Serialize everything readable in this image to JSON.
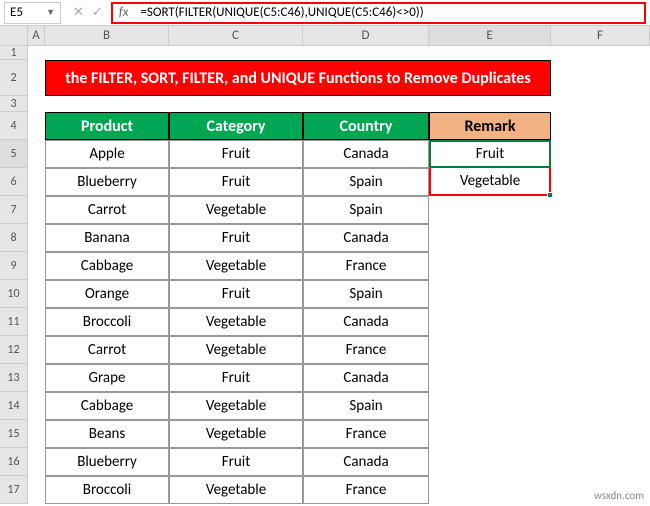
{
  "nameBox": "E5",
  "formula": "=SORT(FILTER(UNIQUE(C5:C46),UNIQUE(C5:C46)<>0))",
  "fxLabel": "fx",
  "banner": "the FILTER, SORT, FILTER, and UNIQUE Functions to Remove Duplicates",
  "colHeaders": [
    "A",
    "B",
    "C",
    "D",
    "E",
    "F"
  ],
  "rowHeaders": [
    "1",
    "2",
    "3",
    "4",
    "5",
    "6",
    "7",
    "8",
    "9",
    "10",
    "11",
    "12",
    "13",
    "14",
    "15",
    "16",
    "17"
  ],
  "tableHeaders": {
    "b": "Product",
    "c": "Category",
    "d": "Country",
    "e": "Remark"
  },
  "remarks": [
    "Fruit",
    "Vegetable"
  ],
  "rows": [
    {
      "b": "Apple",
      "c": "Fruit",
      "d": "Canada"
    },
    {
      "b": "Blueberry",
      "c": "Fruit",
      "d": "Spain"
    },
    {
      "b": "Carrot",
      "c": "Vegetable",
      "d": "Spain"
    },
    {
      "b": "Banana",
      "c": "Fruit",
      "d": "Canada"
    },
    {
      "b": "Cabbage",
      "c": "Vegetable",
      "d": "France"
    },
    {
      "b": "Orange",
      "c": "Fruit",
      "d": "Spain"
    },
    {
      "b": "Broccoli",
      "c": "Vegetable",
      "d": "Canada"
    },
    {
      "b": "Carrot",
      "c": "Vegetable",
      "d": "France"
    },
    {
      "b": "Grape",
      "c": "Fruit",
      "d": "Canada"
    },
    {
      "b": "Cabbage",
      "c": "Vegetable",
      "d": "Spain"
    },
    {
      "b": "Beans",
      "c": "Vegetable",
      "d": "France"
    },
    {
      "b": "Blueberry",
      "c": "Fruit",
      "d": "Canada"
    },
    {
      "b": "Broccoli",
      "c": "Vegetable",
      "d": "France"
    }
  ],
  "watermark": "wsxdn.com"
}
